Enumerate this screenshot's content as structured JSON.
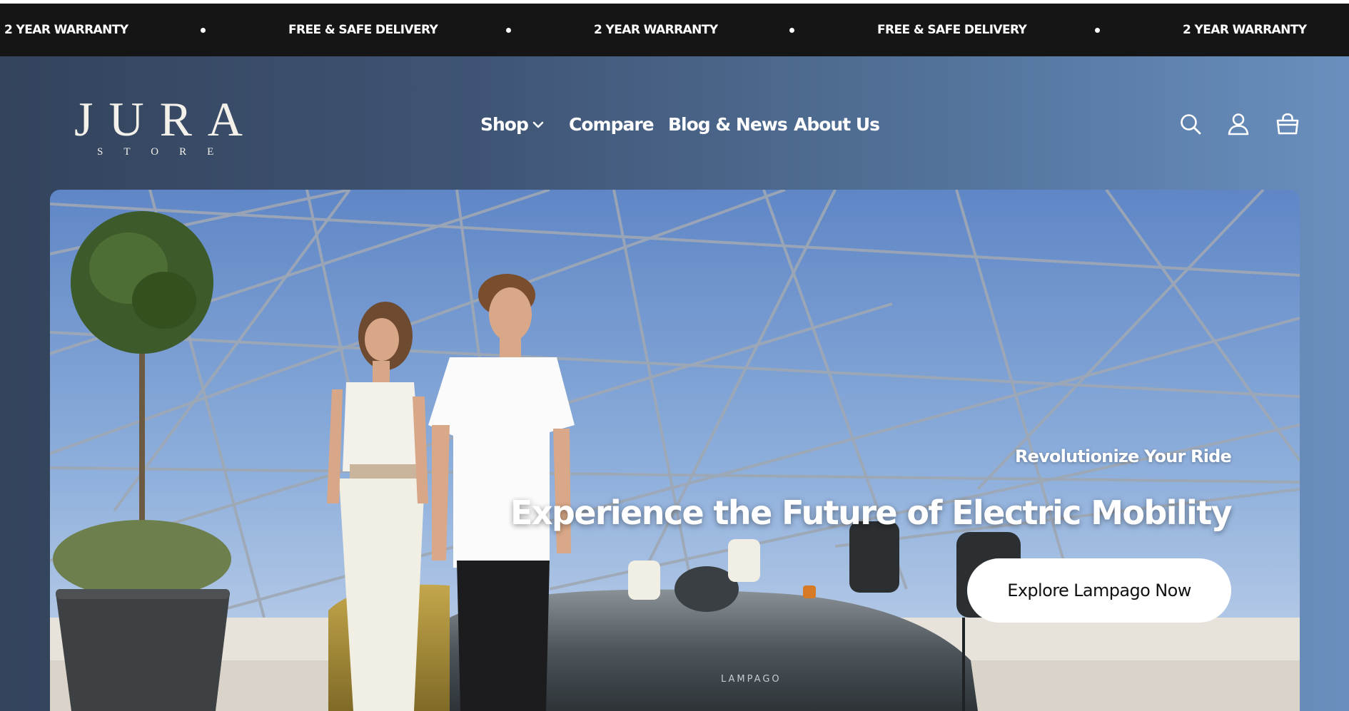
{
  "announcement_bar": {
    "items": [
      "2 YEAR WARRANTY",
      "FREE & SAFE DELIVERY",
      "2 YEAR WARRANTY",
      "FREE & SAFE DELIVERY",
      "2 YEAR WARRANTY"
    ]
  },
  "logo": {
    "wordmark": "JURA",
    "subtitle": "STORE"
  },
  "nav": {
    "items": [
      {
        "label": "Shop",
        "icon": "chevron-down-icon"
      },
      {
        "label": "Compare"
      },
      {
        "label": "Blog & News"
      },
      {
        "label": "About Us"
      }
    ]
  },
  "header_icons": [
    "search-icon",
    "account-icon",
    "cart-icon"
  ],
  "hero": {
    "eyebrow": "Revolutionize Your Ride",
    "headline": "Experience the Future of Electric Mobility",
    "cta_label": "Explore Lampago Now",
    "vehicle_badge": "LAMPAGO"
  },
  "colors": {
    "announcement_bg": "#151515",
    "header_gradient_start": "#33435c",
    "header_gradient_end": "#6a8fbe",
    "cta_bg": "#ffffff"
  }
}
